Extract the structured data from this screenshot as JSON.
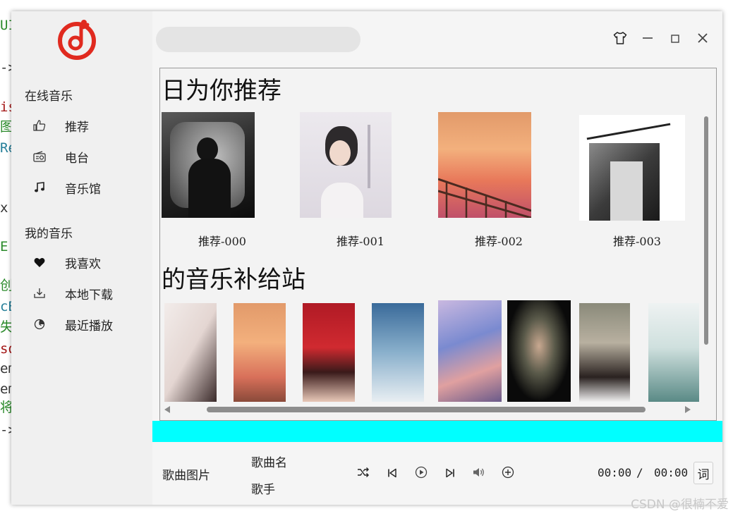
{
  "background_code": {
    "lines": [
      {
        "text": "UI",
        "color": "#2a8a2a"
      },
      {
        "text": "->",
        "color": "#333333"
      },
      {
        "text": "is",
        "color": "#a31515"
      },
      {
        "text": "图,",
        "color": "#2a8a2a"
      },
      {
        "text": "Re",
        "color": "#267f99"
      },
      {
        "text": "x:",
        "color": "#333333"
      },
      {
        "text": "E",
        "color": "#2a8a2a"
      },
      {
        "text": "创",
        "color": "#2a8a2a"
      },
      {
        "text": "cB",
        "color": "#267f99"
      },
      {
        "text": "失",
        "color": "#2a8a2a"
      },
      {
        "text": "so",
        "color": "#a31515"
      },
      {
        "text": "em",
        "color": "#333333"
      },
      {
        "text": "em",
        "color": "#333333"
      },
      {
        "text": "将",
        "color": "#2a8a2a"
      },
      {
        "text": "->",
        "color": "#333333"
      }
    ]
  },
  "sidebar": {
    "online_section": "在线音乐",
    "online_items": [
      {
        "label": "推荐",
        "icon": "thumbs-up-icon"
      },
      {
        "label": "电台",
        "icon": "radio-icon"
      },
      {
        "label": "音乐馆",
        "icon": "music-note-icon"
      }
    ],
    "my_section": "我的音乐",
    "my_items": [
      {
        "label": "我喜欢",
        "icon": "heart-icon"
      },
      {
        "label": "本地下载",
        "icon": "download-icon"
      },
      {
        "label": "最近播放",
        "icon": "recent-icon"
      }
    ]
  },
  "window_controls": {
    "icons": [
      "skin-icon",
      "minimize-icon",
      "maximize-icon",
      "close-icon"
    ]
  },
  "content": {
    "recommend_heading": "日为你推荐",
    "recommend_items": [
      {
        "caption": "推荐-000"
      },
      {
        "caption": "推荐-001"
      },
      {
        "caption": "推荐-002"
      },
      {
        "caption": "推荐-003"
      }
    ],
    "supply_heading": "的音乐补给站",
    "supply_count": 8
  },
  "player": {
    "song_image_label": "歌曲图片",
    "song_name_label": "歌曲名",
    "singer_label": "歌手",
    "current_time": "00:00",
    "time_separator": "/",
    "total_time": "00:00",
    "lyric_button": "词",
    "controls": [
      "shuffle-icon",
      "previous-icon",
      "play-icon",
      "next-icon",
      "volume-icon",
      "add-icon"
    ]
  },
  "watermark": "CSDN @很楠不爱",
  "colors": {
    "brand_red": "#e02a1f",
    "accent_cyan": "#00ffff",
    "window_bg": "#f5f5f5",
    "sidebar_bg": "#f0f0f0"
  }
}
